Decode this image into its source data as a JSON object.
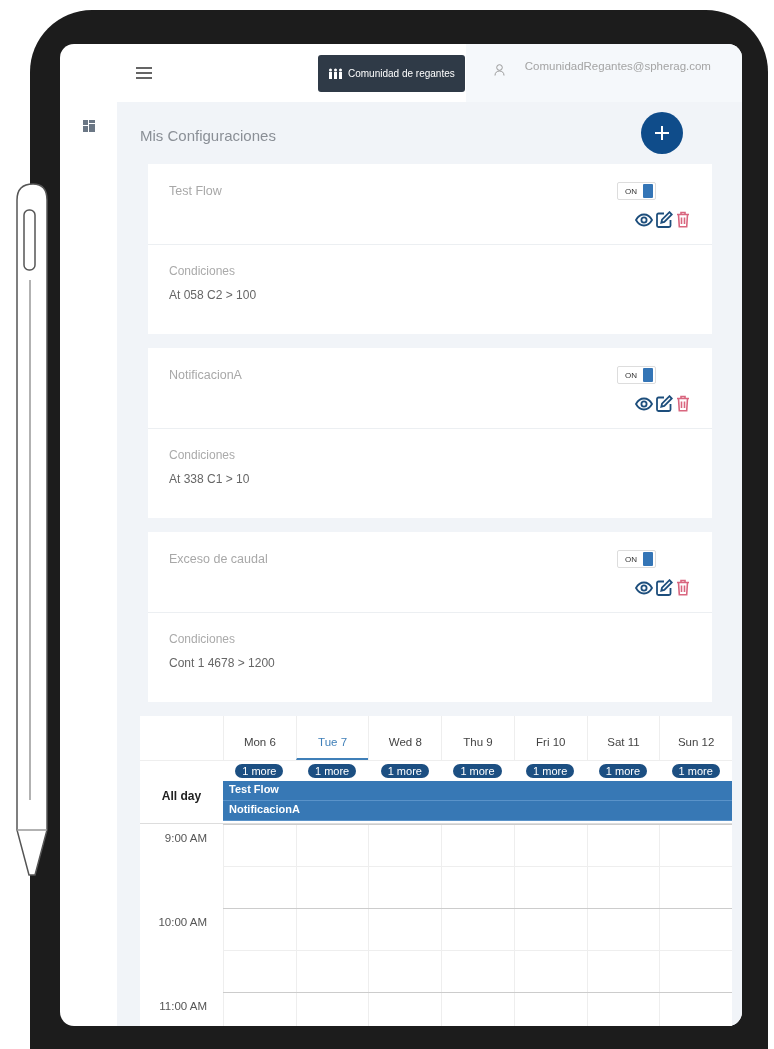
{
  "header": {
    "org_button": "Comunidad de regantes",
    "user_email": "ComunidadRegantes@spherag.com"
  },
  "page_title": "Mis Configuraciones",
  "configurations": [
    {
      "name": "Test Flow",
      "enabled": true,
      "toggle_label": "ON",
      "conditions_label": "Condiciones",
      "condition": "At 058 C2 > 100"
    },
    {
      "name": "NotificacionA",
      "enabled": true,
      "toggle_label": "ON",
      "conditions_label": "Condiciones",
      "condition": "At 338 C1 > 10"
    },
    {
      "name": "Exceso de caudal",
      "enabled": true,
      "toggle_label": "ON",
      "conditions_label": "Condiciones",
      "condition": "Cont 1 4678 > 1200"
    }
  ],
  "calendar": {
    "days": [
      {
        "label": "Mon 6",
        "selected": false,
        "more": "1 more"
      },
      {
        "label": "Tue 7",
        "selected": true,
        "more": "1 more"
      },
      {
        "label": "Wed 8",
        "selected": false,
        "more": "1 more"
      },
      {
        "label": "Thu 9",
        "selected": false,
        "more": "1 more"
      },
      {
        "label": "Fri 10",
        "selected": false,
        "more": "1 more"
      },
      {
        "label": "Sat 11",
        "selected": false,
        "more": "1 more"
      },
      {
        "label": "Sun 12",
        "selected": false,
        "more": "1 more"
      }
    ],
    "all_day_label": "All day",
    "events": [
      {
        "title": "Test Flow"
      },
      {
        "title": "NotificacionA"
      }
    ],
    "times": [
      "9:00 AM",
      "10:00 AM",
      "11:00 AM"
    ]
  }
}
